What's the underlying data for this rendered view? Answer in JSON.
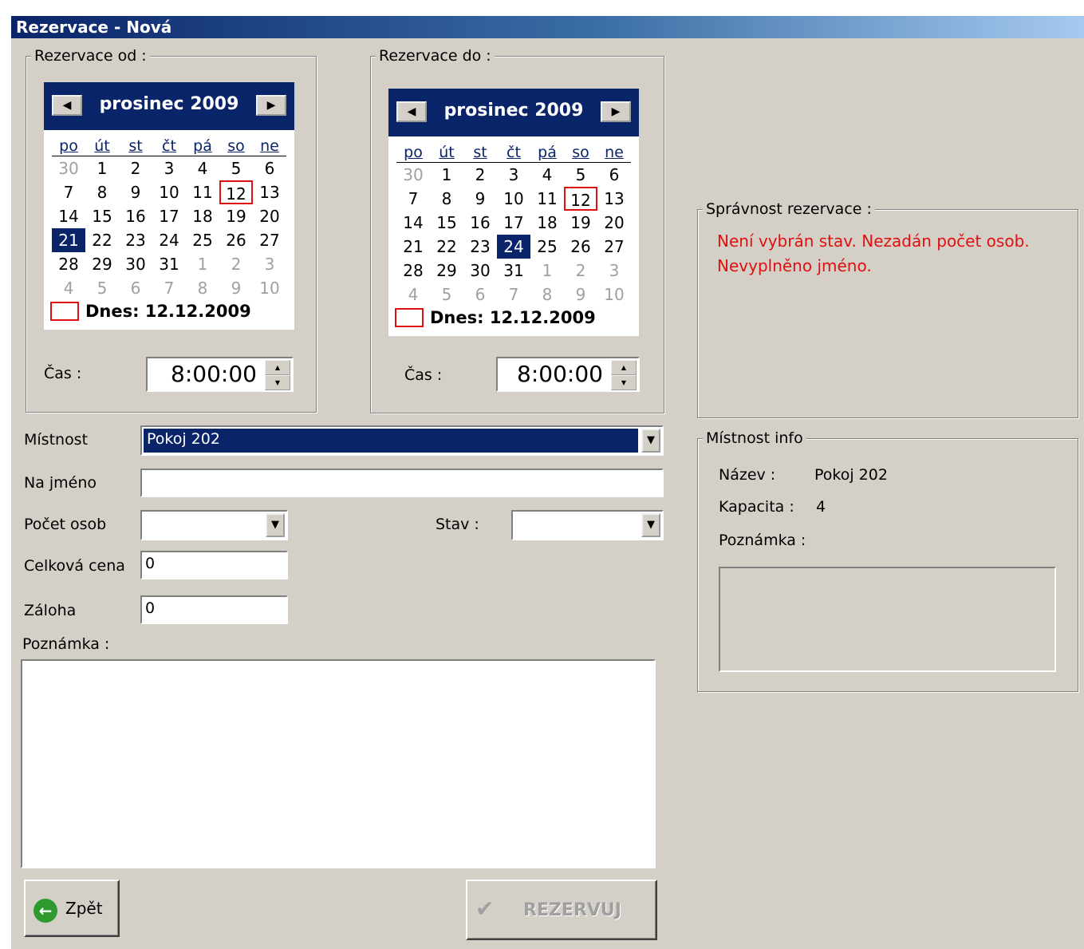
{
  "window": {
    "title": "Rezervace - Nová"
  },
  "from": {
    "label": "Rezervace od :",
    "month_title": "prosinec 2009",
    "prev": "◀",
    "next": "▶",
    "days_of_week": [
      "po",
      "út",
      "st",
      "čt",
      "pá",
      "so",
      "ne"
    ],
    "weeks": [
      [
        "30",
        "1",
        "2",
        "3",
        "4",
        "5",
        "6"
      ],
      [
        "7",
        "8",
        "9",
        "10",
        "11",
        "12",
        "13"
      ],
      [
        "14",
        "15",
        "16",
        "17",
        "18",
        "19",
        "20"
      ],
      [
        "21",
        "22",
        "23",
        "24",
        "25",
        "26",
        "27"
      ],
      [
        "28",
        "29",
        "30",
        "31",
        "1",
        "2",
        "3"
      ],
      [
        "4",
        "5",
        "6",
        "7",
        "8",
        "9",
        "10"
      ]
    ],
    "selected": "21",
    "today_day": "12",
    "today_text": "Dnes: 12.12.2009",
    "time_label": "Čas :",
    "time": "8:00:00"
  },
  "to": {
    "label": "Rezervace do :",
    "month_title": "prosinec 2009",
    "prev": "◀",
    "next": "▶",
    "days_of_week": [
      "po",
      "út",
      "st",
      "čt",
      "pá",
      "so",
      "ne"
    ],
    "weeks": [
      [
        "30",
        "1",
        "2",
        "3",
        "4",
        "5",
        "6"
      ],
      [
        "7",
        "8",
        "9",
        "10",
        "11",
        "12",
        "13"
      ],
      [
        "14",
        "15",
        "16",
        "17",
        "18",
        "19",
        "20"
      ],
      [
        "21",
        "22",
        "23",
        "24",
        "25",
        "26",
        "27"
      ],
      [
        "28",
        "29",
        "30",
        "31",
        "1",
        "2",
        "3"
      ],
      [
        "4",
        "5",
        "6",
        "7",
        "8",
        "9",
        "10"
      ]
    ],
    "selected": "24",
    "today_day": "12",
    "today_text": "Dnes: 12.12.2009",
    "time_label": "Čas :",
    "time": "8:00:00"
  },
  "form": {
    "room_label": "Místnost",
    "room_value": "Pokoj 202",
    "name_label": "Na jméno",
    "name_value": "",
    "persons_label": "Počet osob",
    "persons_value": "",
    "state_label": "Stav :",
    "state_value": "",
    "price_label": "Celková cena",
    "price_value": "0",
    "deposit_label": "Záloha",
    "deposit_value": "0",
    "note_label": "Poznámka :",
    "note_value": ""
  },
  "validity": {
    "label": "Správnost rezervace :",
    "message": "Není vybrán stav. Nezadán počet osob. Nevyplněno jméno."
  },
  "room_info": {
    "label": "Místnost info",
    "name_label": "Název :",
    "name_value": "Pokoj 202",
    "capacity_label": "Kapacita :",
    "capacity_value": "4",
    "note_label": "Poznámka :"
  },
  "buttons": {
    "back": "Zpět",
    "reserve": "REZERVUJ"
  },
  "colors": {
    "titlebar": "#0a246a",
    "error": "#e01010",
    "face": "#d4d0c8"
  }
}
